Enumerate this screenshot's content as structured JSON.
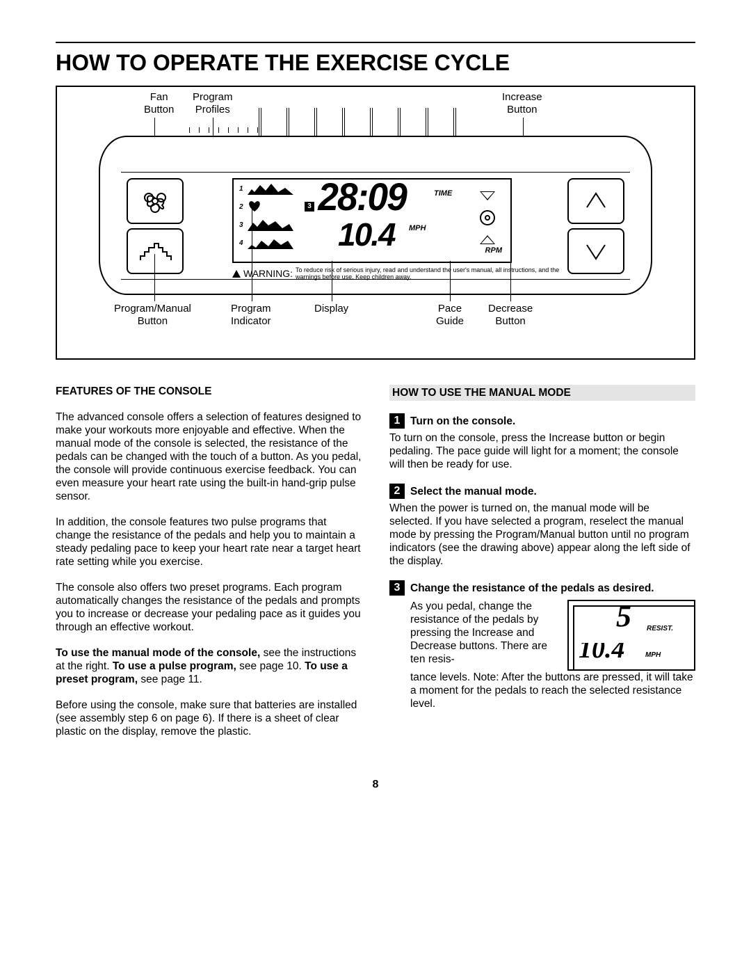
{
  "page_number": "8",
  "heading": "HOW TO OPERATE THE EXERCISE CYCLE",
  "diagram": {
    "callouts": {
      "fan_button": "Fan\nButton",
      "program_profiles": "Program\nProfiles",
      "increase_button": "Increase\nButton",
      "program_manual_button": "Program/Manual\nButton",
      "program_indicator": "Program\nIndicator",
      "display": "Display",
      "pace_guide": "Pace\nGuide",
      "decrease_button": "Decrease\nButton"
    },
    "lcd": {
      "time_value": "28:09",
      "time_label": "TIME",
      "speed_value": "10.4",
      "speed_label": "MPH",
      "rpm_label": "RPM",
      "profile_numbers": [
        "1",
        "2",
        "3",
        "4"
      ],
      "prog_indicator_badge": "3"
    },
    "warning": {
      "label": "WARNING:",
      "text": "To reduce risk of serious injury, read and understand the user's manual, all instructions, and the warnings before use. Keep children away."
    }
  },
  "left_column": {
    "h": "FEATURES OF THE CONSOLE",
    "p1": "The advanced console offers a selection of features designed to make your workouts more enjoyable and effective. When the manual mode of the console is selected, the resistance of the pedals can be changed with the touch of a button. As you pedal, the console will provide continuous exercise feedback. You can even measure your heart rate using the built-in hand-grip pulse sensor.",
    "p2": "In addition, the console features two pulse programs that change the resistance of the pedals and help you to maintain a steady pedaling pace to keep your heart rate near a target heart rate setting while you exercise.",
    "p3": "The console also offers two preset programs. Each program automatically changes the resistance of the pedals and prompts you to increase or decrease your pedaling pace as it guides you through an effective workout.",
    "p4a": "To use the manual mode of the console,",
    "p4b": " see the instructions at the right. ",
    "p4c": "To use a pulse program,",
    "p4d": " see page 10. ",
    "p4e": "To use a preset program,",
    "p4f": " see page 11.",
    "p5": "Before using the console, make sure that batteries are installed (see assembly step 6 on page 6). If there is a sheet of clear plastic on the display, remove the plastic."
  },
  "right_column": {
    "h": "HOW TO USE THE MANUAL MODE",
    "steps": [
      {
        "n": "1",
        "title": "Turn on the console.",
        "body": "To turn on the console, press the Increase button or begin pedaling. The pace guide will light for a moment; the console will then be ready for use."
      },
      {
        "n": "2",
        "title": "Select the manual mode.",
        "body": "When the power is turned on, the manual mode will be selected. If you have selected a program, reselect the manual mode by pressing the Program/Manual button until no program indicators (see the drawing above) appear along the left side of the display."
      },
      {
        "n": "3",
        "title": "Change the resistance of the pedals as desired.",
        "body_a": "As you pedal, change the resistance of the pedals by pressing the Increase and Decrease buttons. There are ten resis",
        "body_b": "tance levels. Note: After the buttons are pressed, it will take a moment for the pedals to reach the selected resistance level."
      }
    ],
    "inset": {
      "resist_label": "RESIST.",
      "mph_label": "MPH",
      "resist_value": "5",
      "partial_value": "10.4"
    }
  }
}
